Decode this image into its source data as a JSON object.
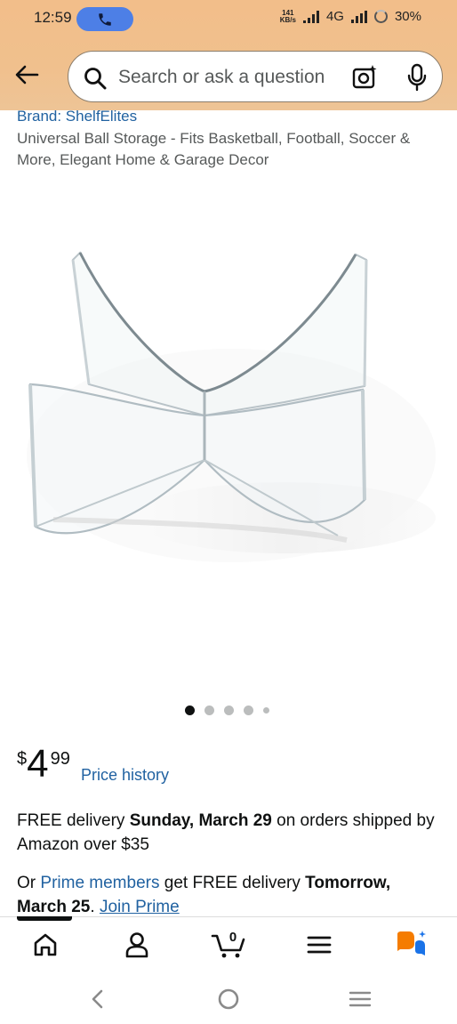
{
  "status_bar": {
    "time": "12:59",
    "net_speed_value": "141",
    "net_speed_unit": "KB/s",
    "network": "4G",
    "battery": "30%",
    "call_pill_color": "#4d7fe6"
  },
  "header": {
    "back_icon": "arrow-left-icon",
    "search": {
      "placeholder": "Search or ask a question",
      "value": "",
      "icons": [
        "search-icon",
        "camera-lens-icon",
        "microphone-icon"
      ]
    }
  },
  "product": {
    "brand": "Brand: ShelfElites",
    "title": "Universal Ball Storage - Fits Basketball, Football, Soccer & More, Elegant Home & Garage Decor",
    "image_alt": "clear acrylic X-shaped ball stand",
    "carousel": {
      "count": 5,
      "active": 1
    },
    "price": {
      "currency": "$",
      "whole": "4",
      "fraction": "99"
    },
    "price_history": "Price history"
  },
  "delivery": {
    "prefix": "FREE delivery ",
    "date": "Sunday, March 29",
    "suffix": " on orders shipped by Amazon over $35"
  },
  "prime": {
    "prefix": "Or ",
    "members_link": "Prime members",
    "middle": " get FREE delivery ",
    "date": "Tomorrow, March 25",
    "dot": ". ",
    "join_link": "Join Prime"
  },
  "bottom_nav": {
    "items": [
      "home-icon",
      "account-icon",
      "cart-icon",
      "menu-icon",
      "rufus-assistant-icon"
    ],
    "cart_count": "0",
    "active": "home"
  },
  "colors": {
    "header_bg": "#f0c08d",
    "link": "#2162a1",
    "text": "#0f1111",
    "muted": "#565959",
    "rufus_orange": "#f57c00",
    "rufus_blue": "#1a73e8"
  }
}
